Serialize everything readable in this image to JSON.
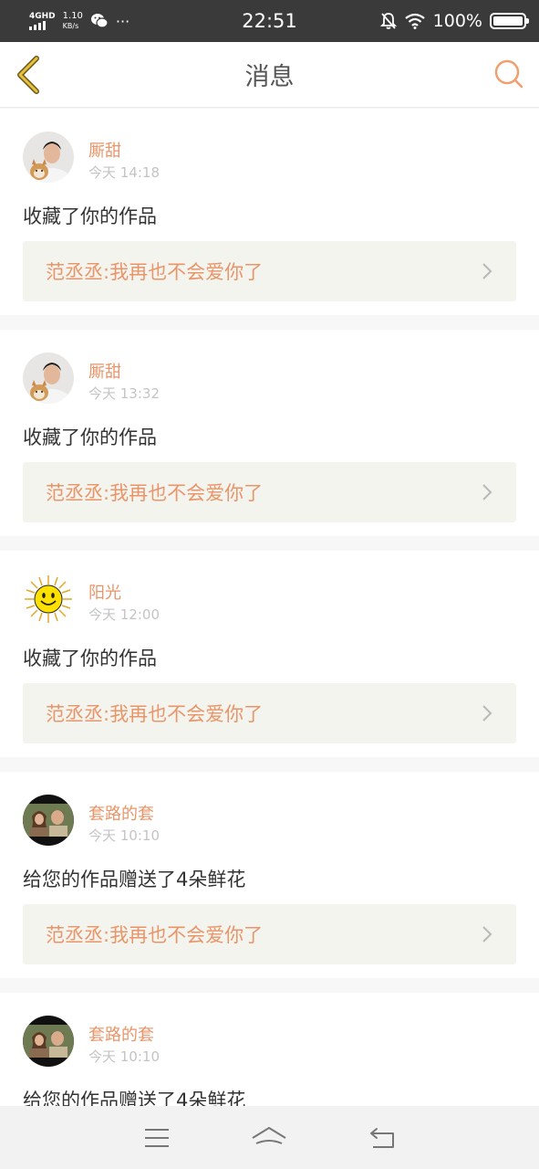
{
  "status_bar": {
    "network": "4GHD",
    "speed_value": "1.10",
    "speed_unit": "KB/s",
    "more": "···",
    "time": "22:51",
    "battery": "100%"
  },
  "header": {
    "title": "消息"
  },
  "messages": [
    {
      "username": "厮甜",
      "time": "今天 14:18",
      "action": "收藏了你的作品",
      "reference": "范丞丞:我再也不会爱你了",
      "avatar": "person-with-dog"
    },
    {
      "username": "厮甜",
      "time": "今天 13:32",
      "action": "收藏了你的作品",
      "reference": "范丞丞:我再也不会爱你了",
      "avatar": "person-with-dog"
    },
    {
      "username": "阳光",
      "time": "今天 12:00",
      "action": "收藏了你的作品",
      "reference": "范丞丞:我再也不会爱你了",
      "avatar": "smiling-sun"
    },
    {
      "username": "套路的套",
      "time": "今天 10:10",
      "action": "给您的作品赠送了4朵鲜花",
      "reference": "范丞丞:我再也不会爱你了",
      "avatar": "movie-still"
    },
    {
      "username": "套路的套",
      "time": "今天 10:10",
      "action": "给您的作品赠送了4朵鲜花",
      "reference": "",
      "avatar": "movie-still"
    }
  ],
  "colors": {
    "accent": "#e8956a",
    "back_icon": "#d4a017",
    "ref_bg": "#f4f4ee"
  },
  "nav_bar": {
    "icons": [
      "menu-icon",
      "home-icon",
      "back-icon"
    ]
  }
}
